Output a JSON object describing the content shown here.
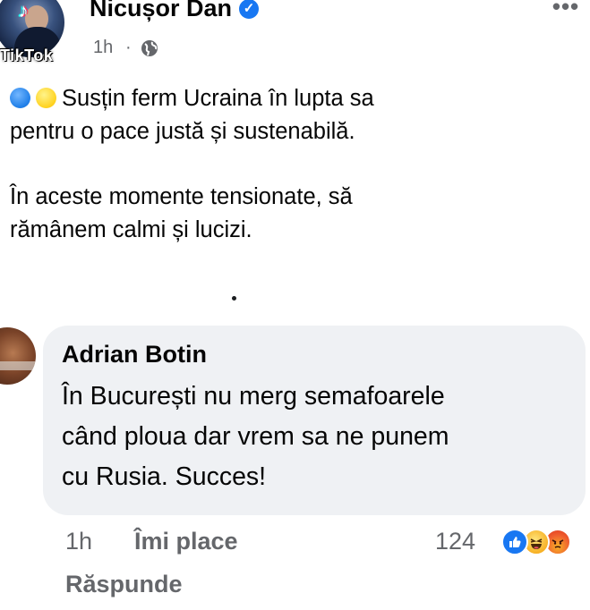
{
  "post": {
    "author": "Nicușor Dan",
    "time": "1h",
    "separator": "·",
    "privacy_icon": "globe-icon",
    "verified_icon": "verified-badge-icon",
    "more_label": "•••",
    "paragraph1_line1": "Susțin ferm Ucraina în lupta sa",
    "paragraph1_line2": "pentru o pace justă și sustenabilă.",
    "paragraph2_line1": "În aceste momente tensionate, să",
    "paragraph2_line2": "rămânem calmi și lucizi.",
    "emojis": [
      "blue-circle",
      "yellow-circle"
    ]
  },
  "watermark": {
    "brand": "TikTok",
    "icon": "tiktok-logo-icon"
  },
  "comment": {
    "author": "Adrian Botin",
    "line1": "În București nu merg semafoarele",
    "line2": "când ploua dar vrem sa ne punem",
    "line3": "cu Rusia. Succes!",
    "time": "1h",
    "like_label": "Îmi place",
    "reply_label": "Răspunde",
    "reaction_count": "124",
    "reactions": [
      "like",
      "haha",
      "angry"
    ]
  },
  "colors": {
    "facebook_blue": "#1877f2",
    "secondary_text": "#65676b",
    "bubble": "#eff1f4"
  }
}
